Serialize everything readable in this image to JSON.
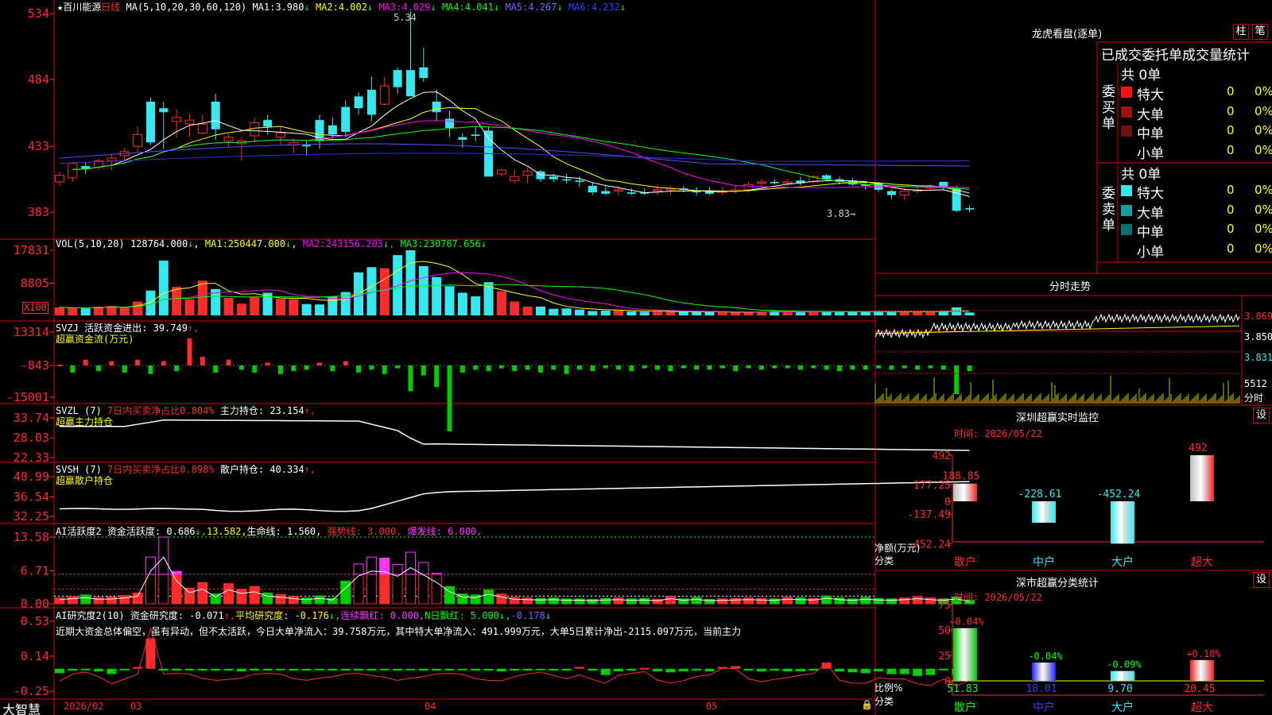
{
  "colors": {
    "up": "#ff2a2a",
    "down": "#35e8ef",
    "grid": "#d40000",
    "ma1": "#ffffff",
    "ma2": "#ffff00",
    "ma3": "#ff00ff",
    "ma4": "#00ff00",
    "ma5": "#5050ff",
    "ma6": "#4040ff",
    "green": "#00cc00",
    "magenta": "#ff33ff",
    "white": "#ffffff",
    "yellow": "#ffff00"
  },
  "kline": {
    "star": "★",
    "name": "百川能源",
    "period": "日线",
    "ma_def": "MA(5,10,20,30,60,120)",
    "ma": [
      {
        "label": "MA1:",
        "value": "3.980",
        "arrow": "↓"
      },
      {
        "label": "MA2:",
        "value": "4.002",
        "arrow": "↓"
      },
      {
        "label": "MA3:",
        "value": "4.029",
        "arrow": "↓"
      },
      {
        "label": "MA4:",
        "value": "4.041",
        "arrow": "↓"
      },
      {
        "label": "MA5:",
        "value": "4.267",
        "arrow": "↓"
      },
      {
        "label": "MA6:",
        "value": "4.232",
        "arrow": "↓"
      }
    ],
    "price_ticks": [
      "534",
      "484",
      "433",
      "383"
    ],
    "high_label": "5.34",
    "low_label": "3.83→"
  },
  "vol": {
    "title": "VOL(5,10,20)",
    "value": "128764.000",
    "arrow": "↓",
    "ma": [
      {
        "label": "MA1:",
        "value": "250447.000",
        "arrow": "↓"
      },
      {
        "label": "MA2:",
        "value": "243156.203",
        "arrow": "↓"
      },
      {
        "label": "MA3:",
        "value": "230787.656",
        "arrow": "↓"
      }
    ],
    "ticks": [
      "17831",
      "8805"
    ],
    "unit": "X100"
  },
  "svzj": {
    "title": "SVZJ",
    "label": "活跃资金进出:",
    "value": "39.749",
    "arrow": "↑,",
    "sub": "超赢资金流(万元)",
    "ticks": [
      "13314",
      "-843",
      "-15001"
    ]
  },
  "svzl": {
    "title": "SVZL (7)",
    "label1": "7日内买卖净占比0.804%",
    "label2": "主力持仓:",
    "value": "23.154",
    "arrow": "↑,",
    "sub": "超赢主力持仓",
    "ticks": [
      "33.74",
      "28.03",
      "22.33"
    ]
  },
  "svsh": {
    "title": "SVSH (7)",
    "label1": "7日内买卖净占比0.898%",
    "label2": "散户持仓:",
    "value": "40.334",
    "arrow": "↑,",
    "sub": "超赢散户持仓",
    "ticks": [
      "40.99",
      "36.54",
      "32.25"
    ]
  },
  "ai1": {
    "title": "AI活跃度2",
    "l1": "资金活跃度:",
    "v1": "0.686",
    "a1": "↓,",
    "v2": "13.582,",
    "l3": "生命线:",
    "v3": "1.560,",
    "l4": "强势线:",
    "v4": "3.000,",
    "l5": "爆发线:",
    "v5": "6.000,",
    "ticks": [
      "13.58",
      "6.71",
      "0.00"
    ]
  },
  "ai2": {
    "title": "AI研究度2(10)",
    "l1": "资金研究度:",
    "v1": "-0.071",
    "a1": "↑,",
    "l2": "平均研究度:",
    "v2": "-0.176",
    "a2": "↓,",
    "l3": "连续飘红:",
    "v3": "0.000,",
    "l4": "N日飘红:",
    "v4": "5.000",
    "a4": "↓,",
    "v5": "-0.178",
    "a5": "↓",
    "comment": "近期大资金总体偏空，虽有异动，但不太活跃，今日大单净流入：39.758万元，其中特大单净流入：491.999万元，大单5日累计净出-2115.097万元，当前主力",
    "ticks": [
      "0.53",
      "0.14",
      "-0.25"
    ]
  },
  "bottom": {
    "brand": "大智慧",
    "dates": [
      "2026/02",
      "03",
      "04",
      "05"
    ]
  },
  "lhb": {
    "title": "龙虎看盘(逐单)",
    "tab1": "柱",
    "tab2": "笔",
    "header": "已成交委托单成交量统计",
    "buy_label": "委买单",
    "sell_label": "委卖单",
    "buy_total": "共 0单",
    "sell_total": "共 0单",
    "rows_buy": [
      {
        "name": "特大",
        "n": "0",
        "pct": "0%",
        "color": "#ff1010"
      },
      {
        "name": "大单",
        "n": "0",
        "pct": "0%",
        "color": "#a01010"
      },
      {
        "name": "中单",
        "n": "0",
        "pct": "0%",
        "color": "#701010"
      },
      {
        "name": "小单",
        "n": "0",
        "pct": "0%",
        "color": ""
      }
    ],
    "rows_sell": [
      {
        "name": "特大",
        "n": "0",
        "pct": "0%",
        "color": "#35e8ef"
      },
      {
        "name": "大单",
        "n": "0",
        "pct": "0%",
        "color": "#10a0a0"
      },
      {
        "name": "中单",
        "n": "0",
        "pct": "0%",
        "color": "#107070"
      },
      {
        "name": "小单",
        "n": "0",
        "pct": "0%",
        "color": ""
      }
    ]
  },
  "fenshi": {
    "title": "分时走势",
    "p1": "3.869",
    "p2": "3.850",
    "p3": "3.831",
    "vol": "5512",
    "unit": "分时"
  },
  "monitor": {
    "title": "深圳超赢实时监控",
    "btn": "设",
    "time": "时间: 2026/05/22",
    "ticks": [
      "492",
      "177.25",
      "0",
      "-137.49",
      "-452.24"
    ],
    "ylabel": "净额(万元)",
    "xlabel": "分类",
    "bars": [
      {
        "name": "散户",
        "label": "188.85",
        "value": 188.85
      },
      {
        "name": "中户",
        "label": "-228.61",
        "value": -228.61
      },
      {
        "name": "大户",
        "label": "-452.24",
        "value": -452.24
      },
      {
        "name": "超大",
        "label": "492",
        "value": 492
      }
    ]
  },
  "stats": {
    "title": "深市超赢分类统计",
    "btn": "设",
    "time": "时间: 2026/05/22",
    "ticks": [
      "75",
      "50",
      "25",
      "0"
    ],
    "ylabel": "比例%",
    "xlabel": "分类",
    "bars": [
      {
        "name": "散户",
        "value": 51.83,
        "label": "51.83",
        "change": "+0.04%"
      },
      {
        "name": "中户",
        "value": 18.01,
        "label": "18.01",
        "change": "-0.04%"
      },
      {
        "name": "大户",
        "value": 9.7,
        "label": "9.70",
        "change": "-0.09%"
      },
      {
        "name": "超大",
        "value": 20.45,
        "label": "20.45",
        "change": "+0.10%"
      }
    ]
  }
}
